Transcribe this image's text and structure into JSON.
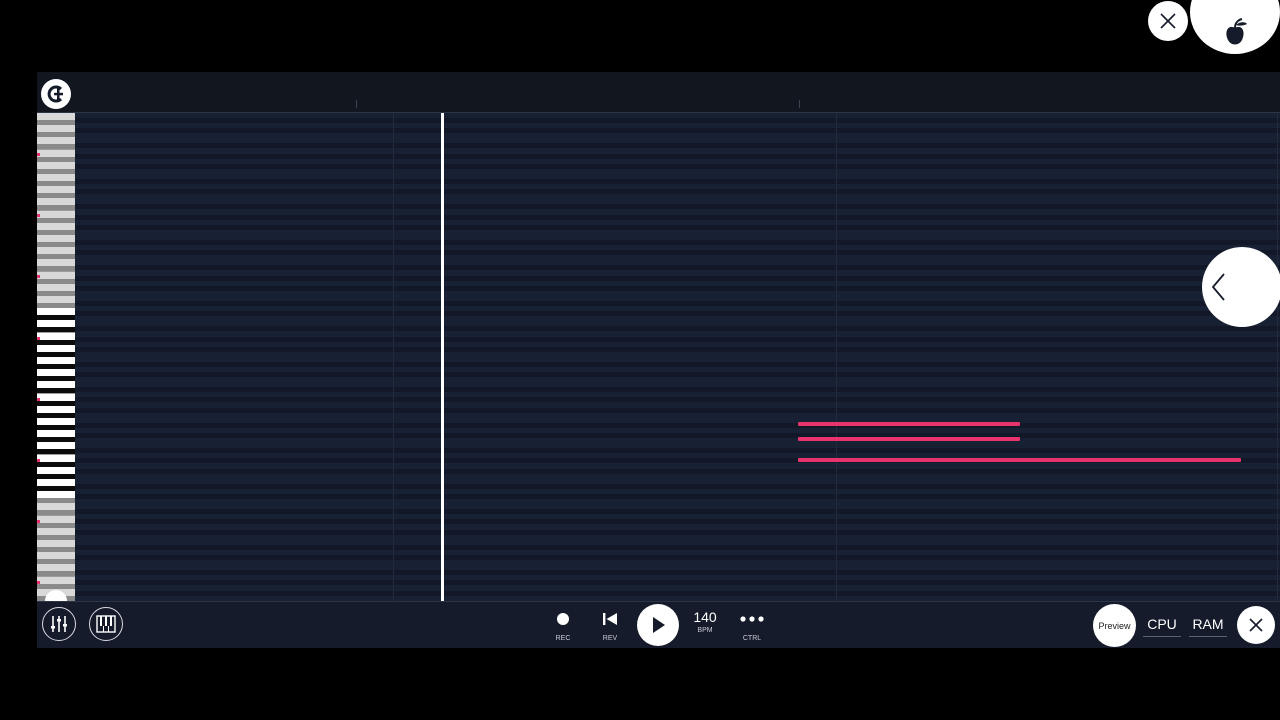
{
  "transport": {
    "rec_label": "REC",
    "rev_label": "REV",
    "bpm_value": "140",
    "bpm_label": "BPM",
    "ctrl_label": "CTRL"
  },
  "right_controls": {
    "preview_label": "Preview",
    "cpu_label": "CPU",
    "ram_label": "RAM"
  },
  "colors": {
    "note": "#e8336c",
    "background": "#151b2b",
    "playhead": "#ffffff"
  },
  "icons": {
    "logo": "c-logo-icon",
    "close": "close-icon",
    "fl_logo": "fruit-logo-icon",
    "collapse": "chevron-left-icon",
    "mixer": "mixer-icon",
    "piano": "piano-icon",
    "record": "record-icon",
    "rewind": "rewind-icon",
    "play": "play-icon",
    "more": "more-icon"
  }
}
